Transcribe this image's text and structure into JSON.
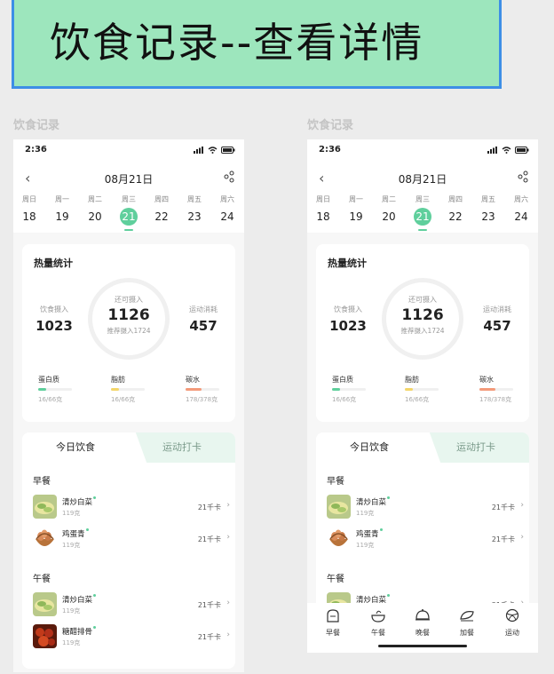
{
  "banner": {
    "title": "饮食记录--查看详情"
  },
  "sections": [
    "饮食记录",
    "饮食记录"
  ],
  "status": {
    "time": "2:36"
  },
  "header": {
    "date": "08月21日"
  },
  "week": [
    {
      "name": "周日",
      "num": "18"
    },
    {
      "name": "周一",
      "num": "19"
    },
    {
      "name": "周二",
      "num": "20"
    },
    {
      "name": "周三",
      "num": "21"
    },
    {
      "name": "周四",
      "num": "22"
    },
    {
      "name": "周五",
      "num": "23"
    },
    {
      "name": "周六",
      "num": "24"
    }
  ],
  "selected_day": 3,
  "stats": {
    "title": "热量统计",
    "intake_label": "饮食摄入",
    "intake": "1023",
    "remain_label": "还可摄入",
    "remain": "1126",
    "recommend": "推荐摄入1724",
    "burn_label": "运动消耗",
    "burn": "457"
  },
  "nutrients": [
    {
      "name": "蛋白质",
      "value": "16/66克",
      "color": "#5fcf9c",
      "progress": 0.24
    },
    {
      "name": "脂肪",
      "value": "16/66克",
      "color": "#f3d66a",
      "progress": 0.24
    },
    {
      "name": "碳水",
      "value": "178/378克",
      "color": "#f39a7a",
      "progress": 0.47
    }
  ],
  "tabs": {
    "active": "今日饮食",
    "inactive": "运动打卡"
  },
  "meals": {
    "breakfast": "早餐",
    "lunch": "午餐"
  },
  "foods": [
    {
      "name": "清炒白菜",
      "weight": "119克",
      "kcal": "21千卡"
    },
    {
      "name": "鸡蛋青",
      "weight": "119克",
      "kcal": "21千卡"
    },
    {
      "name": "清炒白菜",
      "weight": "119克",
      "kcal": "21千卡"
    },
    {
      "name": "糖醋排骨",
      "weight": "119克",
      "kcal": "21千卡"
    }
  ],
  "nav": [
    "早餐",
    "午餐",
    "晚餐",
    "加餐",
    "运动"
  ],
  "colors": {
    "accent": "#5fcf9c",
    "banner": "#9de6bd",
    "banner_border": "#3d8ee6"
  }
}
